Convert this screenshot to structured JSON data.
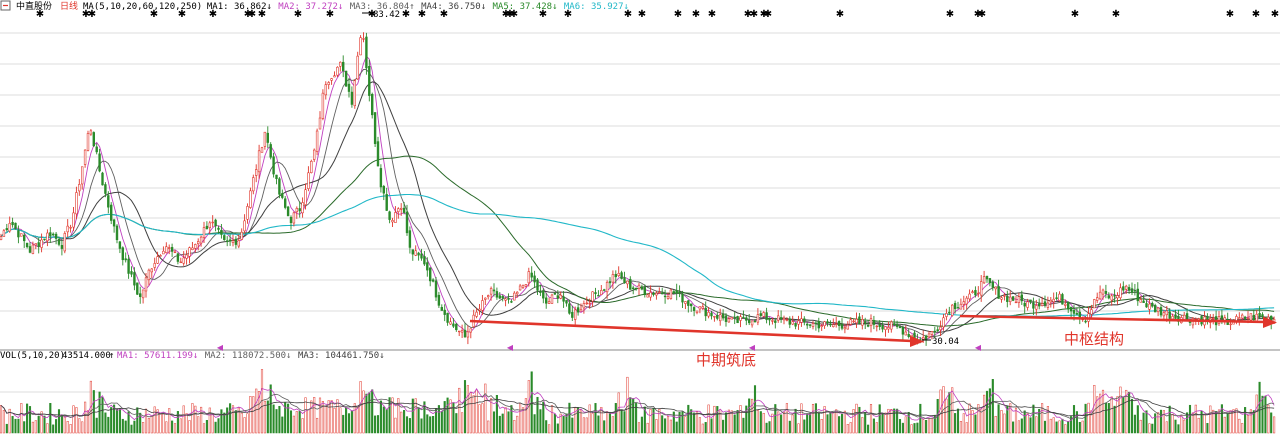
{
  "header": {
    "stock_name": "中直股份",
    "period": "日线",
    "ma_title": "MA(5,10,20,60,120,250)",
    "ma": [
      {
        "label": "MA1:",
        "value": "36.862",
        "arrow": "↓",
        "color": "#000000"
      },
      {
        "label": "MA2:",
        "value": "37.272",
        "arrow": "↓",
        "color": "#c040c0"
      },
      {
        "label": "MA3:",
        "value": "36.804",
        "arrow": "↑",
        "color": "#606060"
      },
      {
        "label": "MA4:",
        "value": "36.750",
        "arrow": "↓",
        "color": "#404040"
      },
      {
        "label": "MA5:",
        "value": "37.428",
        "arrow": "↓",
        "color": "#2a8a2a"
      },
      {
        "label": "MA6:",
        "value": "35.927",
        "arrow": "↓",
        "color": "#22b8c8"
      }
    ]
  },
  "volume_header": {
    "title": "VOL(5,10,20)",
    "value": "43514.000",
    "arrow0": "↑",
    "ma": [
      {
        "label": "MA1:",
        "value": "57611.199",
        "arrow": "↓",
        "color": "#c040c0"
      },
      {
        "label": "MA2:",
        "value": "118072.500",
        "arrow": "↓",
        "color": "#606060"
      },
      {
        "label": "MA3:",
        "value": "104461.750",
        "arrow": "↓",
        "color": "#404040"
      }
    ]
  },
  "annotations": {
    "high_label": "83.42",
    "low_label": "30.04",
    "text1": "中期筑底",
    "text2": "中枢结构"
  },
  "colors": {
    "up": "#e0352b",
    "down": "#2a8a2a",
    "arrow": "#e0352b",
    "ma_short": "#c040c0",
    "ma_mid": "#404040",
    "ma_60": "#2a6a2a",
    "ma_long": "#22b8c8",
    "grid": "#dcdcdc"
  },
  "chart_data": {
    "type": "candlestick",
    "x_axis": "trading days",
    "price_high": 83.42,
    "price_low": 30.04,
    "price_path_keypoints": [
      [
        0,
        47
      ],
      [
        10,
        50
      ],
      [
        30,
        45
      ],
      [
        50,
        48
      ],
      [
        62,
        46
      ],
      [
        72,
        50
      ],
      [
        90,
        66
      ],
      [
        100,
        58
      ],
      [
        115,
        48
      ],
      [
        125,
        43
      ],
      [
        140,
        37
      ],
      [
        150,
        42
      ],
      [
        165,
        46
      ],
      [
        180,
        43
      ],
      [
        195,
        46
      ],
      [
        210,
        50
      ],
      [
        225,
        46
      ],
      [
        240,
        47
      ],
      [
        255,
        58
      ],
      [
        265,
        65
      ],
      [
        278,
        55
      ],
      [
        290,
        50
      ],
      [
        300,
        52
      ],
      [
        315,
        62
      ],
      [
        325,
        73
      ],
      [
        340,
        76
      ],
      [
        352,
        70
      ],
      [
        362,
        83
      ],
      [
        370,
        70
      ],
      [
        380,
        57
      ],
      [
        390,
        50
      ],
      [
        402,
        53
      ],
      [
        410,
        45
      ],
      [
        425,
        43
      ],
      [
        440,
        36
      ],
      [
        450,
        33
      ],
      [
        465,
        30.5
      ],
      [
        475,
        34
      ],
      [
        490,
        38
      ],
      [
        510,
        36
      ],
      [
        530,
        41
      ],
      [
        545,
        36
      ],
      [
        560,
        38
      ],
      [
        570,
        34
      ],
      [
        590,
        37
      ],
      [
        605,
        39
      ],
      [
        615,
        41
      ],
      [
        630,
        39
      ],
      [
        650,
        38
      ],
      [
        675,
        38
      ],
      [
        690,
        36
      ],
      [
        710,
        34.5
      ],
      [
        735,
        33
      ],
      [
        760,
        34
      ],
      [
        790,
        33
      ],
      [
        830,
        32.5
      ],
      [
        870,
        33
      ],
      [
        900,
        32
      ],
      [
        920,
        30.04
      ],
      [
        935,
        31.5
      ],
      [
        950,
        35.5
      ],
      [
        970,
        37
      ],
      [
        985,
        40
      ],
      [
        1000,
        37.5
      ],
      [
        1030,
        36
      ],
      [
        1060,
        37
      ],
      [
        1085,
        33.5
      ],
      [
        1100,
        38
      ],
      [
        1112,
        37
      ],
      [
        1125,
        39
      ],
      [
        1150,
        35.5
      ],
      [
        1175,
        34
      ],
      [
        1200,
        33.5
      ],
      [
        1230,
        33
      ],
      [
        1250,
        34
      ],
      [
        1275,
        33.5
      ]
    ],
    "ma_periods": [
      5,
      10,
      20,
      60,
      120,
      250
    ],
    "volume_periods": [
      5,
      10,
      20
    ]
  }
}
